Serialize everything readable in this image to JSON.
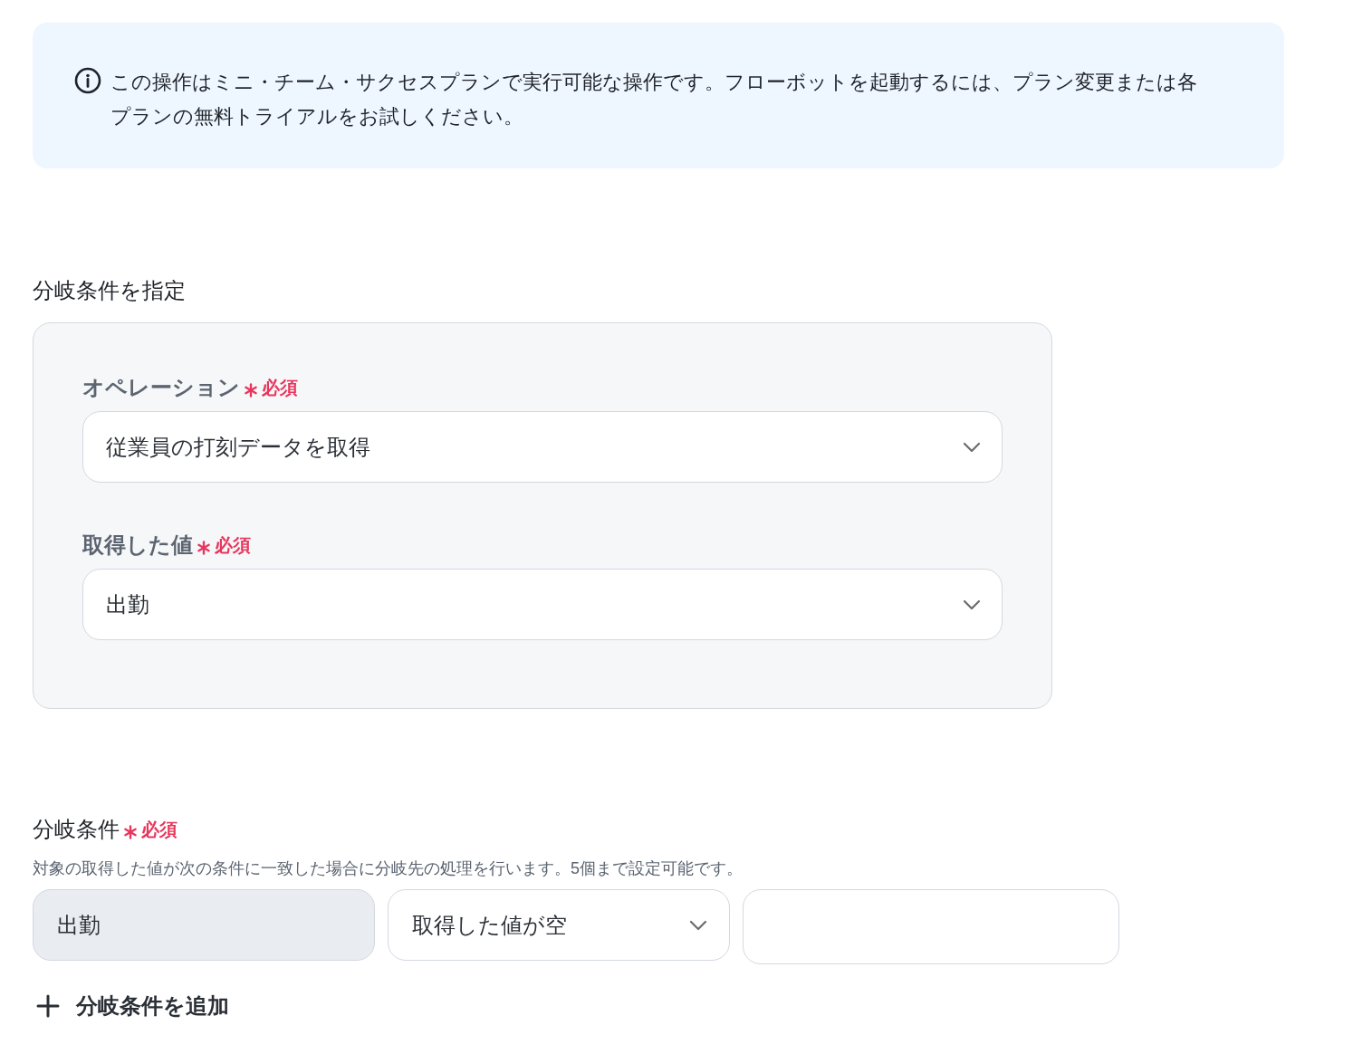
{
  "notice": {
    "text": "この操作はミニ・チーム・サクセスプランで実行可能な操作です。フローボットを起動するには、プラン変更または各プランの無料トライアルをお試しください。"
  },
  "operation_section": {
    "title": "分岐条件を指定",
    "fields": [
      {
        "label": "オペレーション",
        "required": true,
        "required_label": "必須",
        "value": "従業員の打刻データを取得"
      },
      {
        "label": "取得した値",
        "required": true,
        "required_label": "必須",
        "value": "出勤"
      }
    ]
  },
  "condition_section": {
    "title": "分岐条件",
    "required": true,
    "required_label": "必須",
    "description": "対象の取得した値が次の条件に一致した場合に分岐先の処理を行います。5個まで設定可能です。",
    "conditions": [
      {
        "field": "出勤",
        "operator": "取得した値が空"
      }
    ],
    "add_button": {
      "label": "分岐条件を追加"
    }
  }
}
